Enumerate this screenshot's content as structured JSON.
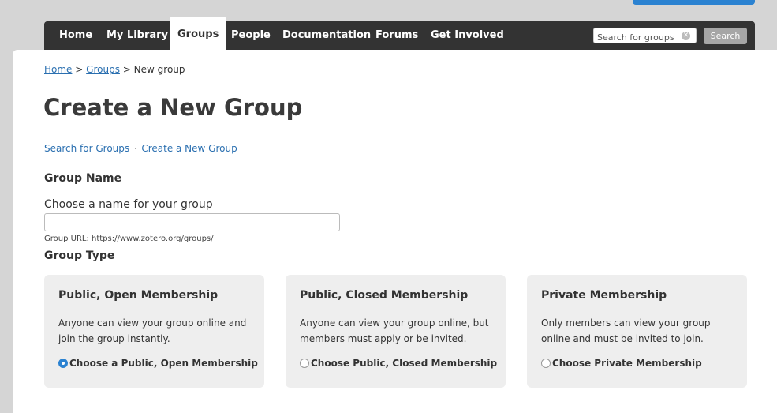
{
  "nav": {
    "items": [
      {
        "label": "Home"
      },
      {
        "label": "My Library"
      },
      {
        "label": "Groups",
        "active": true
      },
      {
        "label": "People"
      },
      {
        "label": "Documentation"
      },
      {
        "label": "Forums"
      },
      {
        "label": "Get Involved"
      }
    ],
    "search_placeholder": "Search for groups",
    "search_button": "Search"
  },
  "breadcrumb": {
    "home": "Home",
    "sep1": ">",
    "groups": "Groups",
    "sep2": ">",
    "current": "New group"
  },
  "page": {
    "title": "Create a New Group",
    "links": {
      "search": "Search for Groups",
      "separator": "·",
      "create": "Create a New Group"
    },
    "group_name": {
      "heading": "Group Name",
      "label": "Choose a name for your group",
      "value": "",
      "url_hint": "Group URL: https://www.zotero.org/groups/"
    },
    "group_type": {
      "heading": "Group Type",
      "options": [
        {
          "title": "Public, Open Membership",
          "description": "Anyone can view your group online and join the group instantly.",
          "choice": "Choose a Public, Open Membership",
          "selected": true
        },
        {
          "title": "Public, Closed Membership",
          "description": "Anyone can view your group online, but members must apply or be invited.",
          "choice": "Choose Public, Closed Membership",
          "selected": false
        },
        {
          "title": "Private Membership",
          "description": "Only members can view your group online and must be invited to join.",
          "choice": "Choose Private Membership",
          "selected": false
        }
      ]
    }
  },
  "colors": {
    "nav_bg": "#333333",
    "link": "#2a6fb0",
    "accent": "#2b82d1",
    "card_bg": "#eeeeee"
  }
}
